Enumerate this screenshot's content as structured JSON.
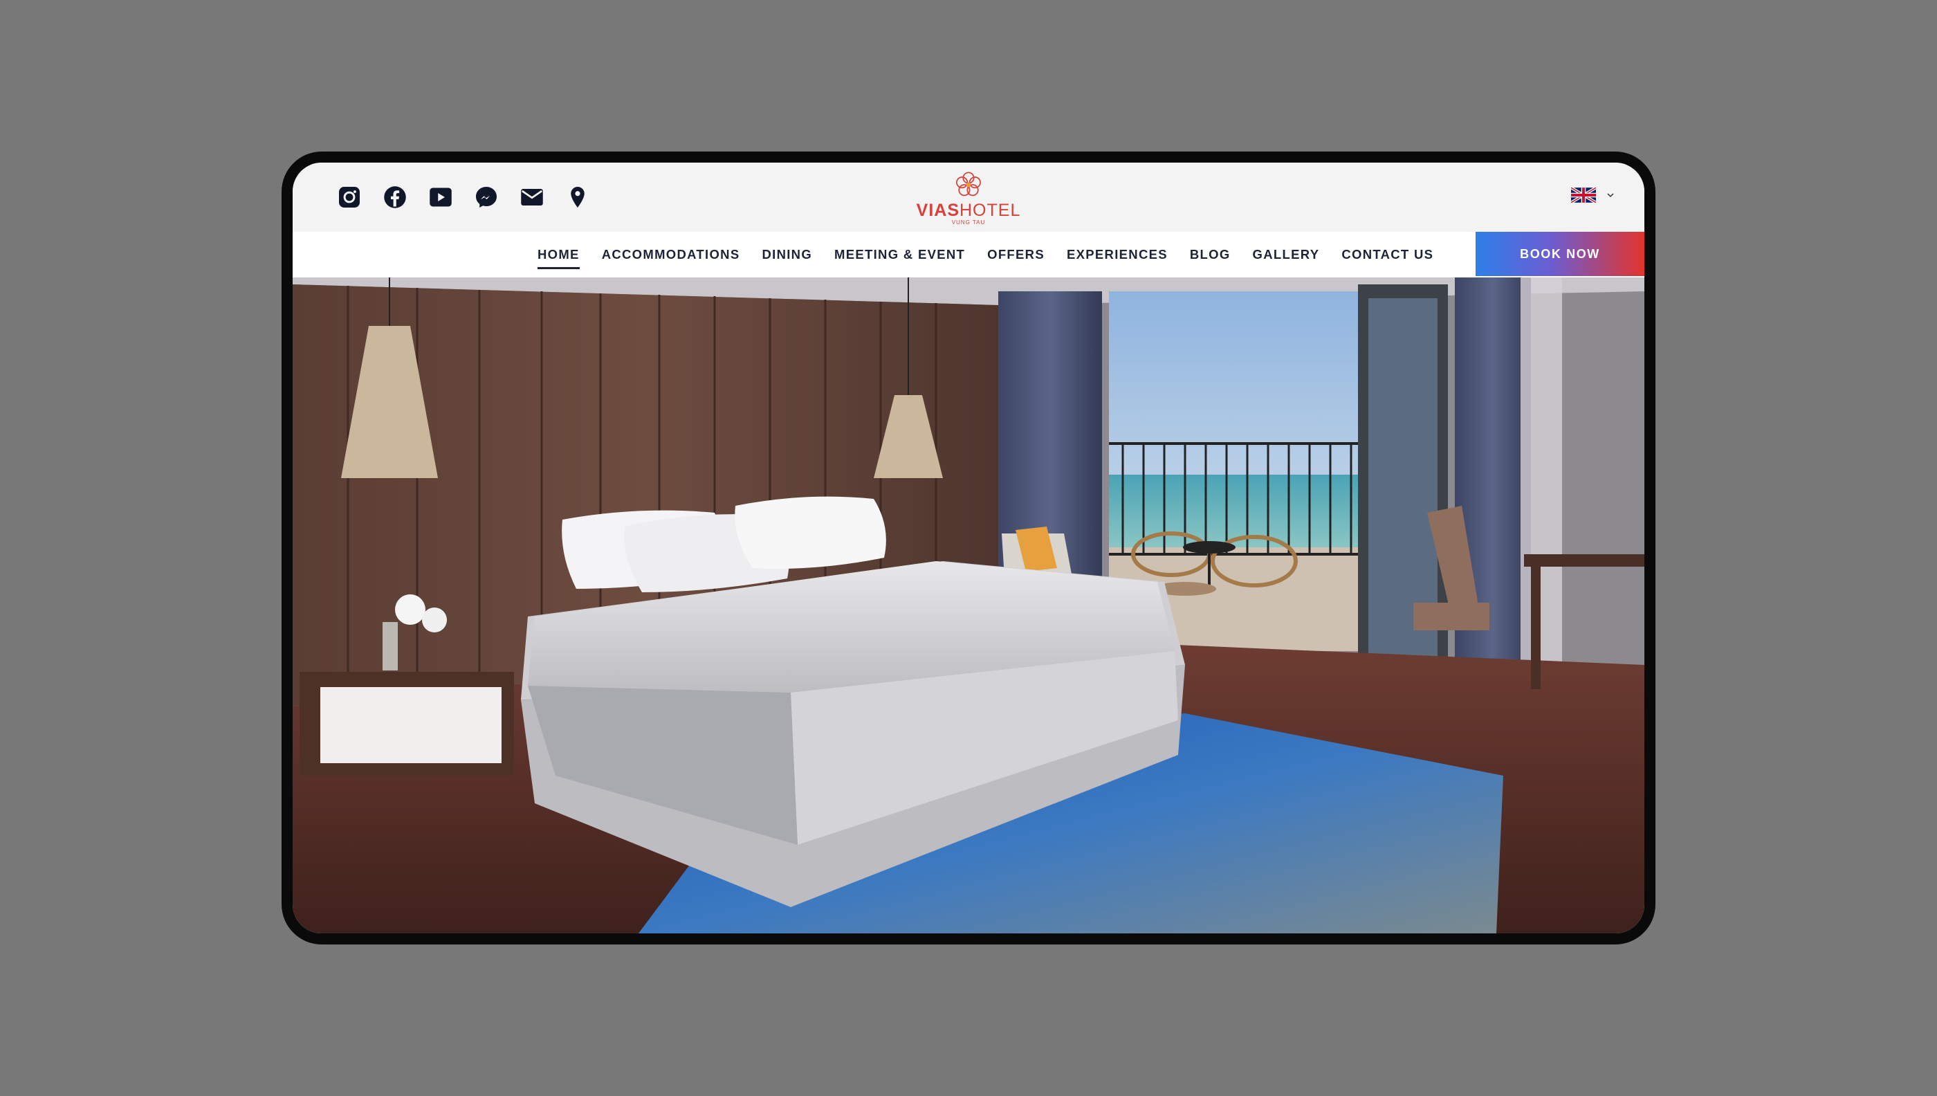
{
  "social": {
    "icons": [
      "instagram-icon",
      "facebook-icon",
      "youtube-icon",
      "messenger-icon",
      "mail-icon",
      "location-pin-icon"
    ],
    "color": "#10172a"
  },
  "logo": {
    "name_bold": "VIAS",
    "name_light": "HOTEL",
    "subtitle": "VUNG TAU",
    "color": "#d8413a"
  },
  "language": {
    "icon": "uk-flag-icon"
  },
  "nav": {
    "items": [
      {
        "label": "HOME",
        "active": true
      },
      {
        "label": "ACCOMMODATIONS"
      },
      {
        "label": "DINING"
      },
      {
        "label": "MEETING & EVENT"
      },
      {
        "label": "OFFERS"
      },
      {
        "label": "EXPERIENCES"
      },
      {
        "label": "BLOG"
      },
      {
        "label": "GALLERY"
      },
      {
        "label": "CONTACT US"
      }
    ]
  },
  "book_button": {
    "label": "BOOK NOW",
    "gradient": [
      "#2f7fe8",
      "#e2342c"
    ]
  },
  "hero": {
    "image": "hotel-room-photo"
  },
  "colors": {
    "page_background": "#787878",
    "device_frame": "#0a0a0a",
    "header_background": "#f3f3f3",
    "nav_text": "#1d2336"
  }
}
